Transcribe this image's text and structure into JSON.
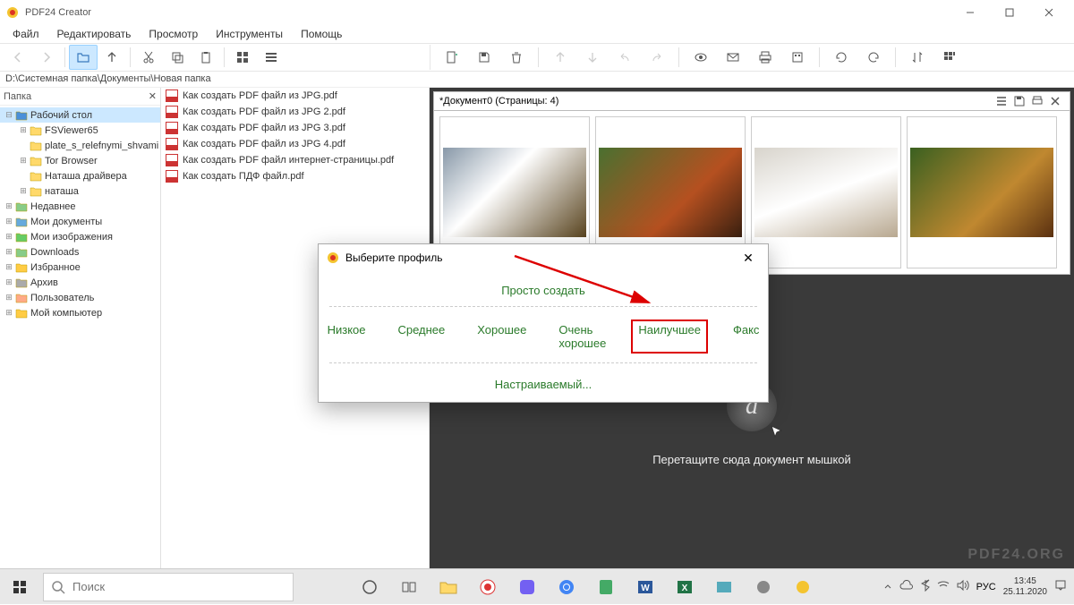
{
  "app": {
    "title": "PDF24 Creator"
  },
  "menu": [
    "Файл",
    "Редактировать",
    "Просмотр",
    "Инструменты",
    "Помощь"
  ],
  "path": "D:\\Системная папка\\Документы\\Новая папка",
  "left_header": "Папка",
  "tree": [
    {
      "exp": "-",
      "icon": "desktop",
      "label": "Рабочий стол",
      "indent": 0,
      "sel": true
    },
    {
      "exp": "+",
      "icon": "folder",
      "label": "FSViewer65",
      "indent": 1
    },
    {
      "exp": "",
      "icon": "folder",
      "label": "plate_s_relefnymi_shvami",
      "indent": 1
    },
    {
      "exp": "+",
      "icon": "folder",
      "label": "Tor Browser",
      "indent": 1
    },
    {
      "exp": "",
      "icon": "folder",
      "label": "Наташа драйвера",
      "indent": 1
    },
    {
      "exp": "+",
      "icon": "folder",
      "label": "наташа",
      "indent": 1
    },
    {
      "exp": "+",
      "icon": "recent",
      "label": "Недавнее",
      "indent": 0
    },
    {
      "exp": "+",
      "icon": "docs",
      "label": "Мои документы",
      "indent": 0
    },
    {
      "exp": "+",
      "icon": "pics",
      "label": "Мои изображения",
      "indent": 0
    },
    {
      "exp": "+",
      "icon": "downloads",
      "label": "Downloads",
      "indent": 0
    },
    {
      "exp": "+",
      "icon": "star",
      "label": "Избранное",
      "indent": 0
    },
    {
      "exp": "+",
      "icon": "archive",
      "label": "Архив",
      "indent": 0
    },
    {
      "exp": "+",
      "icon": "user",
      "label": "Пользователь",
      "indent": 0
    },
    {
      "exp": "+",
      "icon": "computer",
      "label": "Мой компьютер",
      "indent": 0
    }
  ],
  "files": [
    "Как создать PDF файл из JPG.pdf",
    "Как создать PDF файл из JPG 2.pdf",
    "Как создать PDF файл из JPG 3.pdf",
    "Как создать PDF файл из JPG 4.pdf",
    "Как создать PDF файл интернет-страницы.pdf",
    "Как создать ПДФ файл.pdf"
  ],
  "doc": {
    "title": "*Документ0 (Страницы: 4)"
  },
  "thumbs": [
    "eagle",
    "redpanda",
    "cat",
    "lion"
  ],
  "drop_text": "Перетащите сюда документ мышкой",
  "watermark": "PDF24.ORG",
  "dialog": {
    "title": "Выберите профиль",
    "create": "Просто создать",
    "options": [
      "Низкое",
      "Среднее",
      "Хорошее",
      "Очень хорошее",
      "Наилучшее",
      "Факс"
    ],
    "highlight_index": 4,
    "custom": "Настраиваемый..."
  },
  "search_placeholder": "Поиск",
  "clock": {
    "time": "13:45",
    "date": "25.11.2020"
  },
  "lang": "РУС"
}
